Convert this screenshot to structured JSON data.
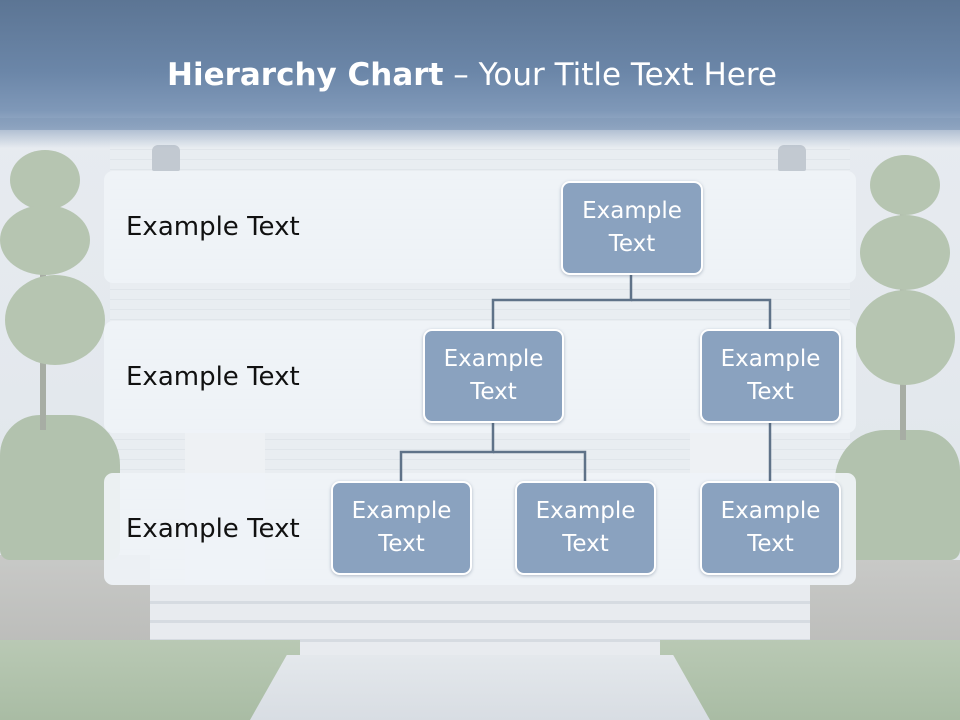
{
  "title": {
    "bold": "Hierarchy Chart",
    "rest": " – Your Title Text Here"
  },
  "levels": [
    {
      "label": "Example Text"
    },
    {
      "label": "Example Text"
    },
    {
      "label": "Example Text"
    }
  ],
  "nodes": [
    {
      "id": "root",
      "text": "Example Text"
    },
    {
      "id": "level2-left",
      "text": "Example Text"
    },
    {
      "id": "level2-right",
      "text": "Example Text"
    },
    {
      "id": "level3-left",
      "text": "Example Text"
    },
    {
      "id": "level3-middle",
      "text": "Example Text"
    },
    {
      "id": "level3-right",
      "text": "Example Text"
    }
  ],
  "edges": [
    {
      "from": "root",
      "to": "level2-left"
    },
    {
      "from": "root",
      "to": "level2-right"
    },
    {
      "from": "level2-left",
      "to": "level3-left"
    },
    {
      "from": "level2-left",
      "to": "level3-middle"
    },
    {
      "from": "level2-right",
      "to": "level3-right"
    }
  ],
  "colors": {
    "title_band": "#6b86a8",
    "node_fill": "#8aa2bf",
    "node_border": "#ffffff",
    "connector": "#5f7288",
    "band_fill": "#eff3f7"
  }
}
